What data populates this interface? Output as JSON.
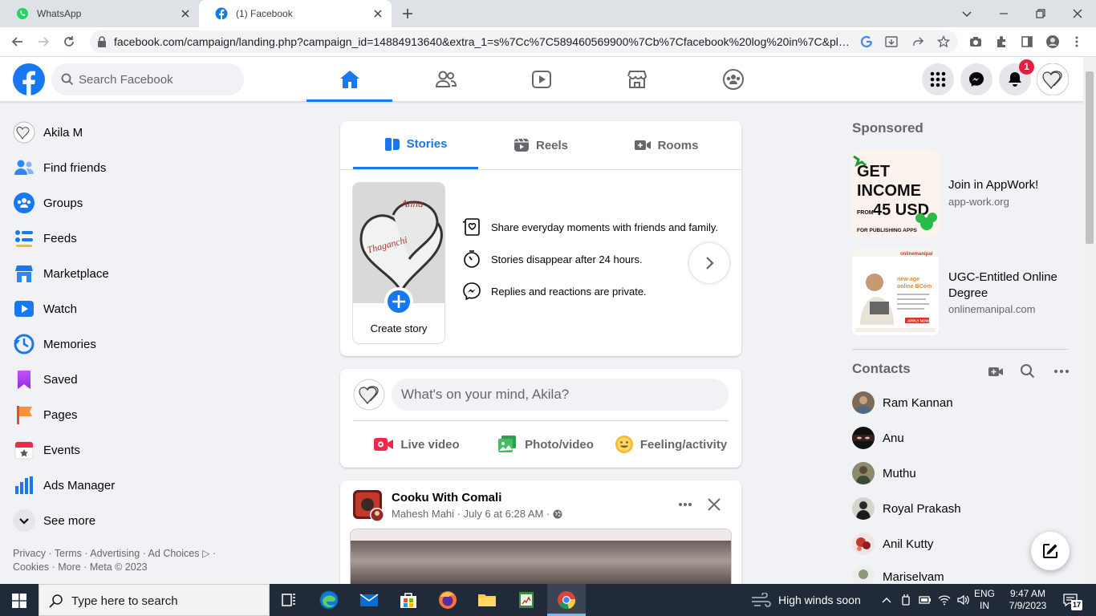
{
  "browser": {
    "tabs": [
      {
        "title": "WhatsApp",
        "icon": "whatsapp-icon"
      },
      {
        "title": "(1) Facebook",
        "icon": "facebook-icon"
      }
    ],
    "url": "facebook.com/campaign/landing.php?campaign_id=14884913640&extra_1=s%7Cc%7C589460569900%7Cb%7Cfacebook%20log%20in%7C&place..."
  },
  "header": {
    "search_placeholder": "Search Facebook",
    "nav": [
      "home-icon",
      "friends-icon",
      "watch-icon",
      "marketplace-icon",
      "groups-icon"
    ],
    "notification_count": "1"
  },
  "sidebar": {
    "items": [
      {
        "label": "Akila M",
        "icon": "avatar"
      },
      {
        "label": "Find friends",
        "icon": "friends-icon"
      },
      {
        "label": "Groups",
        "icon": "groups-icon"
      },
      {
        "label": "Feeds",
        "icon": "feeds-icon"
      },
      {
        "label": "Marketplace",
        "icon": "marketplace-icon"
      },
      {
        "label": "Watch",
        "icon": "watch-icon"
      },
      {
        "label": "Memories",
        "icon": "memories-icon"
      },
      {
        "label": "Saved",
        "icon": "saved-icon"
      },
      {
        "label": "Pages",
        "icon": "pages-icon"
      },
      {
        "label": "Events",
        "icon": "events-icon"
      },
      {
        "label": "Ads Manager",
        "icon": "ads-manager-icon"
      },
      {
        "label": "See more",
        "icon": "chevron-down-icon"
      }
    ],
    "footer": "Privacy · Terms · Advertising · Ad Choices ▷ · Cookies · More · Meta © 2023"
  },
  "stories": {
    "tabs": [
      "Stories",
      "Reels",
      "Rooms"
    ],
    "create_label": "Create story",
    "info": [
      "Share everyday moments with friends and family.",
      "Stories disappear after 24 hours.",
      "Replies and reactions are private."
    ]
  },
  "composer": {
    "placeholder": "What's on your mind, Akila?",
    "actions": [
      "Live video",
      "Photo/video",
      "Feeling/activity"
    ],
    "colors": {
      "live": "#f02849",
      "photo": "#45bd62",
      "feeling": "#f7b928"
    }
  },
  "post": {
    "page_name": "Cooku With Comali",
    "meta": "Mahesh Mahi · July 6 at 6:28 AM ·"
  },
  "right": {
    "sponsored_heading": "Sponsored",
    "ads": [
      {
        "title": "Join in AppWork!",
        "url": "app-work.org",
        "img_text": [
          "GET",
          "INCOME",
          "FROM",
          "45 USD",
          "FOR PUBLISHING APPS"
        ]
      },
      {
        "title": "UGC-Entitled Online Degree",
        "url": "onlinemanipal.com",
        "img_text": [
          "onlinemanipal",
          "new-age",
          "online BCom",
          "APPLY NOW"
        ]
      }
    ],
    "contacts_heading": "Contacts",
    "contacts": [
      "Ram Kannan",
      "Anu",
      "Muthu",
      "Royal Prakash",
      "Anil Kutty",
      "Mariselvam"
    ]
  },
  "taskbar": {
    "search_text": "Type here to search",
    "weather": "High winds soon",
    "lang": [
      "ENG",
      "IN"
    ],
    "time": "9:47 AM",
    "date": "7/9/2023",
    "notifications": "17"
  },
  "colors": {
    "brand": "#1877f2",
    "badge": "#e41e3f"
  }
}
